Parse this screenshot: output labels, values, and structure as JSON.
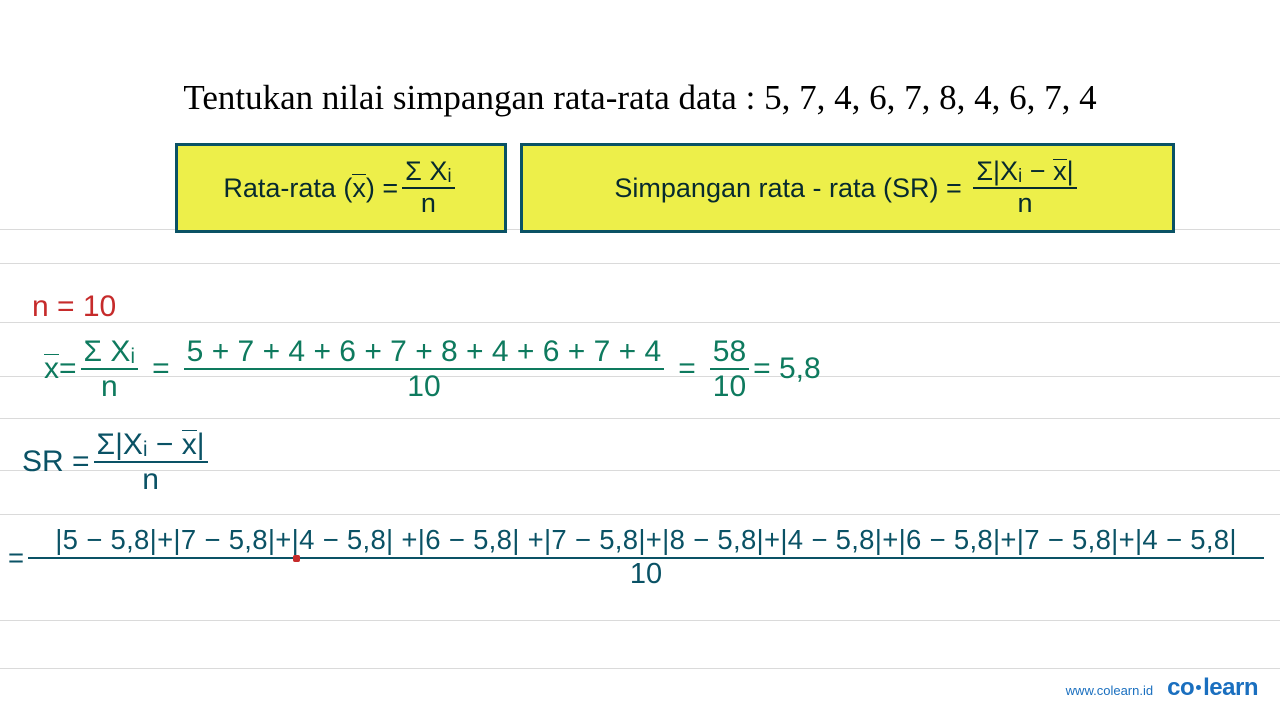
{
  "title": "Tentukan nilai simpangan rata-rata data : 5, 7, 4, 6, 7, 8, 4, 6, 7, 4",
  "formula_box1": {
    "label_prefix": "Rata-rata (",
    "label_suffix": ") =",
    "num": "Σ Xᵢ",
    "den": "n"
  },
  "formula_box2": {
    "label": "Simpangan rata - rata (SR) =",
    "num_prefix": "Σ|Xᵢ − ",
    "num_suffix": "|",
    "den": "n"
  },
  "n_line": "n = 10",
  "mean": {
    "lhs_x": "x",
    "eq1": " = ",
    "f1_num": "Σ Xᵢ",
    "f1_den": "n",
    "eq2": " = ",
    "f2_num": "5 + 7 + 4 + 6 + 7 + 8 + 4 + 6 + 7 + 4",
    "f2_den": "10",
    "eq3": " = ",
    "f3_num": "58",
    "f3_den": "10",
    "eq4": " = 5,8"
  },
  "sr": {
    "lhs": "SR = ",
    "num_prefix": "Σ|Xᵢ − ",
    "num_x": "x",
    "num_suffix": "|",
    "den": "n"
  },
  "expand": {
    "eq": "= ",
    "num": "|5 − 5,8|+|7 − 5,8|+|4 − 5,8| +|6 − 5,8| +|7 − 5,8|+|8 − 5,8|+|4 − 5,8|+|6 − 5,8|+|7 − 5,8|+|4 − 5,8|",
    "den": "10"
  },
  "footer": {
    "url": "www.colearn.id",
    "brand_pre": "co",
    "brand_post": "learn"
  }
}
